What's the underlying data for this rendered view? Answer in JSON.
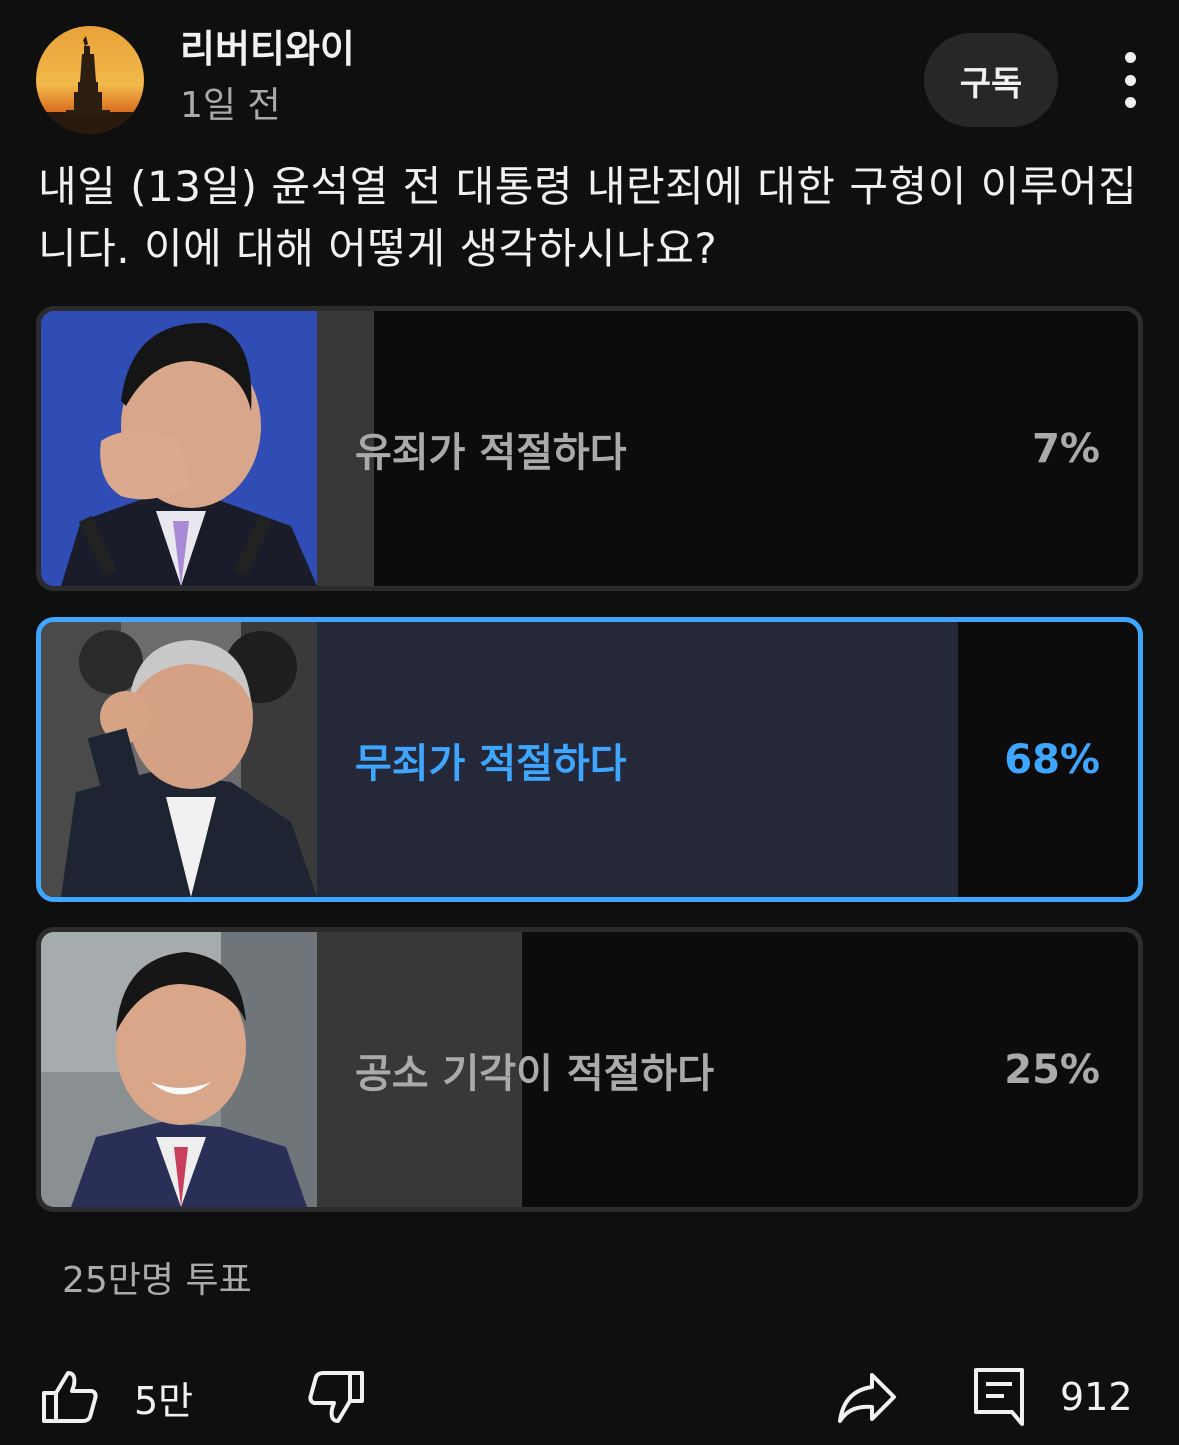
{
  "post": {
    "channel_name": "리버티와이",
    "time": "1일 전",
    "subscribe_label": "구독",
    "avatar_icon": "statue-of-liberty-sunset-avatar",
    "more_icon": "vertical-dots-icon"
  },
  "poll": {
    "question": "내일 (13일) 윤석열 전 대통령 내란죄에 대한 구형이 이루어집니다. 이에 대해 어떻게 생각하시나요?",
    "options": [
      {
        "label": "유죄가 적절하다",
        "percent_text": "7%",
        "percent": 7,
        "selected": false
      },
      {
        "label": "무죄가 적절하다",
        "percent_text": "68%",
        "percent": 68,
        "selected": true
      },
      {
        "label": "공소 기각이 적절하다",
        "percent_text": "25%",
        "percent": 25,
        "selected": false
      }
    ],
    "vote_count": "25만명 투표",
    "selected_color": "#3ea6ff"
  },
  "actions": {
    "like_count": "5만",
    "comment_count": "912",
    "like_icon": "thumbs-up-icon",
    "dislike_icon": "thumbs-down-icon",
    "share_icon": "share-icon",
    "comment_icon": "comment-icon"
  }
}
